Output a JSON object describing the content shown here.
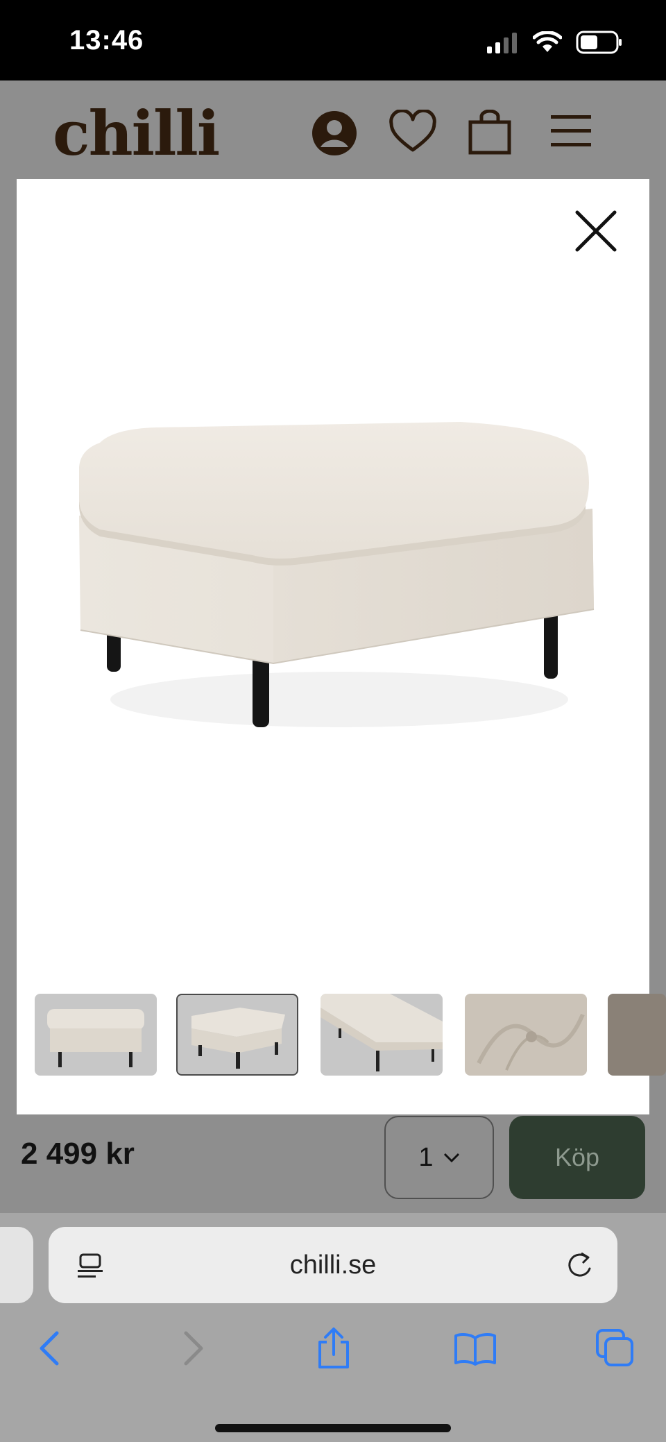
{
  "status": {
    "time": "13:46"
  },
  "header": {
    "logo": "chilli"
  },
  "buy": {
    "price": "2 499 kr",
    "quantity": "1",
    "buy_label": "Köp"
  },
  "browser": {
    "url": "chilli.se"
  },
  "colors": {
    "accent_green": "#2e3d30",
    "safari_blue": "#2f7cf6",
    "logo_brown": "#2b1a0c"
  },
  "icons": [
    "account-icon",
    "heart-icon",
    "bag-icon",
    "menu-icon",
    "close-icon",
    "reader-icon",
    "reload-icon",
    "back-icon",
    "forward-icon",
    "share-icon",
    "bookmarks-icon",
    "tabs-icon"
  ]
}
